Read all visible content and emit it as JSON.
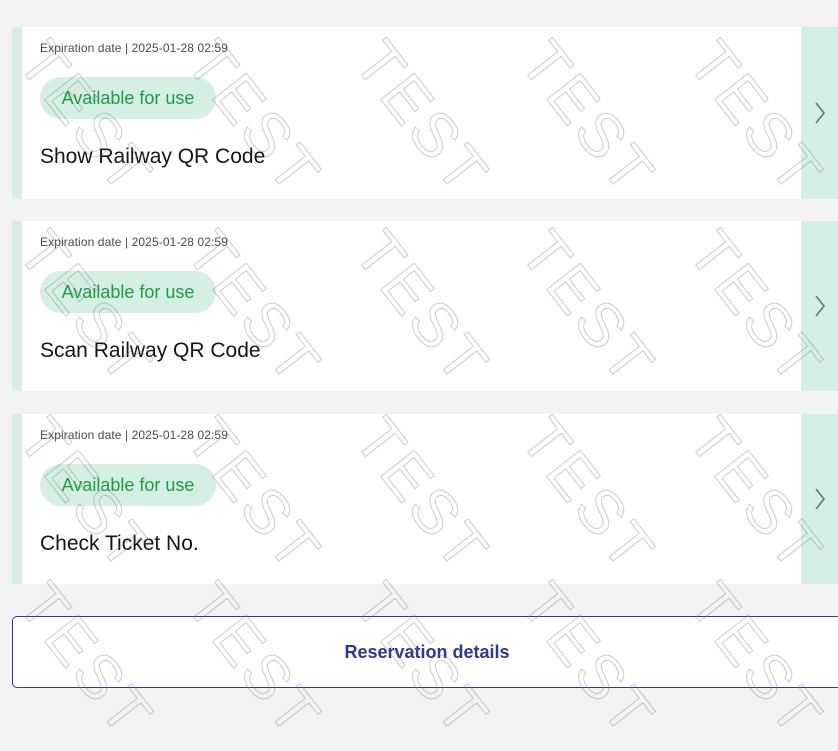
{
  "tickets": [
    {
      "expiration": "Expiration date | 2025-01-28 02:59",
      "status": "Available for use",
      "title": "Show Railway QR Code"
    },
    {
      "expiration": "Expiration date | 2025-01-28 02:59",
      "status": "Available for use",
      "title": "Scan Railway QR Code"
    },
    {
      "expiration": "Expiration date | 2025-01-28 02:59",
      "status": "Available for use",
      "title": "Check Ticket No."
    }
  ],
  "reservation_button": {
    "label": "Reservation details"
  },
  "watermark_text": "TEST",
  "colors": {
    "card_accent": "#d6efe6",
    "badge_bg": "#d5efe4",
    "badge_text": "#1f9a45",
    "button_border": "#2c3a8c"
  },
  "icons": {
    "card_arrow": "chevron-right-icon"
  }
}
